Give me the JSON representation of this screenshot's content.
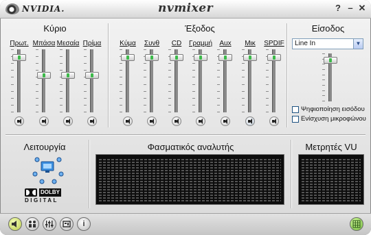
{
  "titlebar": {
    "brand": "NVIDIA.",
    "title": "nvmixer",
    "help": "?",
    "minimize": "–",
    "close": "✕"
  },
  "main": {
    "title": "Κύριο",
    "channels": [
      {
        "label": "Πρωτ.",
        "level": 0.92,
        "muted": false
      },
      {
        "label": "Μπάσα",
        "level": 0.6,
        "muted": false
      },
      {
        "label": "Μεσαία",
        "level": 0.6,
        "muted": false
      },
      {
        "label": "Πρίμα",
        "level": 0.6,
        "muted": false
      }
    ]
  },
  "output": {
    "title": "Έξοδος",
    "channels": [
      {
        "label": "Κύμα",
        "level": 0.92,
        "muted": false
      },
      {
        "label": "Συνθ",
        "level": 0.92,
        "muted": false
      },
      {
        "label": "CD",
        "level": 0.92,
        "muted": false
      },
      {
        "label": "Γραμμή",
        "level": 0.92,
        "muted": false
      },
      {
        "label": "Aux",
        "level": 0.92,
        "muted": false
      },
      {
        "label": "Μικ",
        "level": 0.92,
        "muted": true
      },
      {
        "label": "SPDIF",
        "level": 0.92,
        "muted": false
      }
    ]
  },
  "input": {
    "title": "Είσοδος",
    "source_selected": "Line In",
    "level": 0.92,
    "options": [
      {
        "label": "Ψηφιοποίηση εισόδου",
        "checked": false
      },
      {
        "label": "Ενίσχυση μικροφώνου",
        "checked": false
      }
    ]
  },
  "mode": {
    "title": "Λειτουργία",
    "dolby_word": "DOLBY",
    "dolby_sub": "DIGITAL"
  },
  "analyzer": {
    "title": "Φασματικός αναλυτής"
  },
  "vu": {
    "title": "Μετρητές VU"
  },
  "toolbar": {
    "buttons": [
      {
        "name": "mixer-view-button",
        "icon": "speaker-icon",
        "active": true
      },
      {
        "name": "speaker-setup-button",
        "icon": "people-icon",
        "active": false
      },
      {
        "name": "equalizer-button",
        "icon": "equalizer-icon",
        "active": false
      },
      {
        "name": "presets-button",
        "icon": "presets-icon",
        "active": false
      },
      {
        "name": "info-button",
        "icon": "info-icon",
        "active": false
      }
    ],
    "info_glyph": "i"
  },
  "colors": {
    "slider_accent": "#3db94a",
    "analyzer_bg": "#0d0d0d",
    "analyzer_bar": "#545454"
  }
}
